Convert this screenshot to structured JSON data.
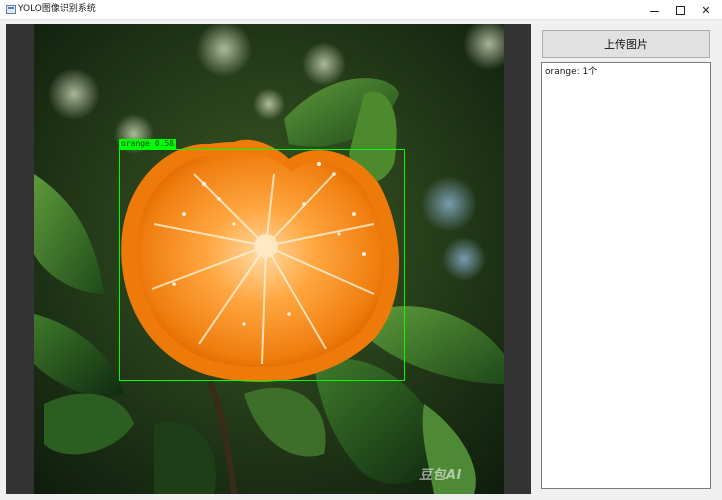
{
  "window": {
    "title": "YOLO图像识别系统",
    "buttons": {
      "minimize": "minimize",
      "maximize": "maximize",
      "close": "✕"
    }
  },
  "detection": {
    "label": "orange  0.58",
    "box_color": "#00ff00"
  },
  "image": {
    "watermark": "豆包AI"
  },
  "sidebar": {
    "upload_label": "上传图片",
    "results": [
      "orange: 1个"
    ]
  }
}
